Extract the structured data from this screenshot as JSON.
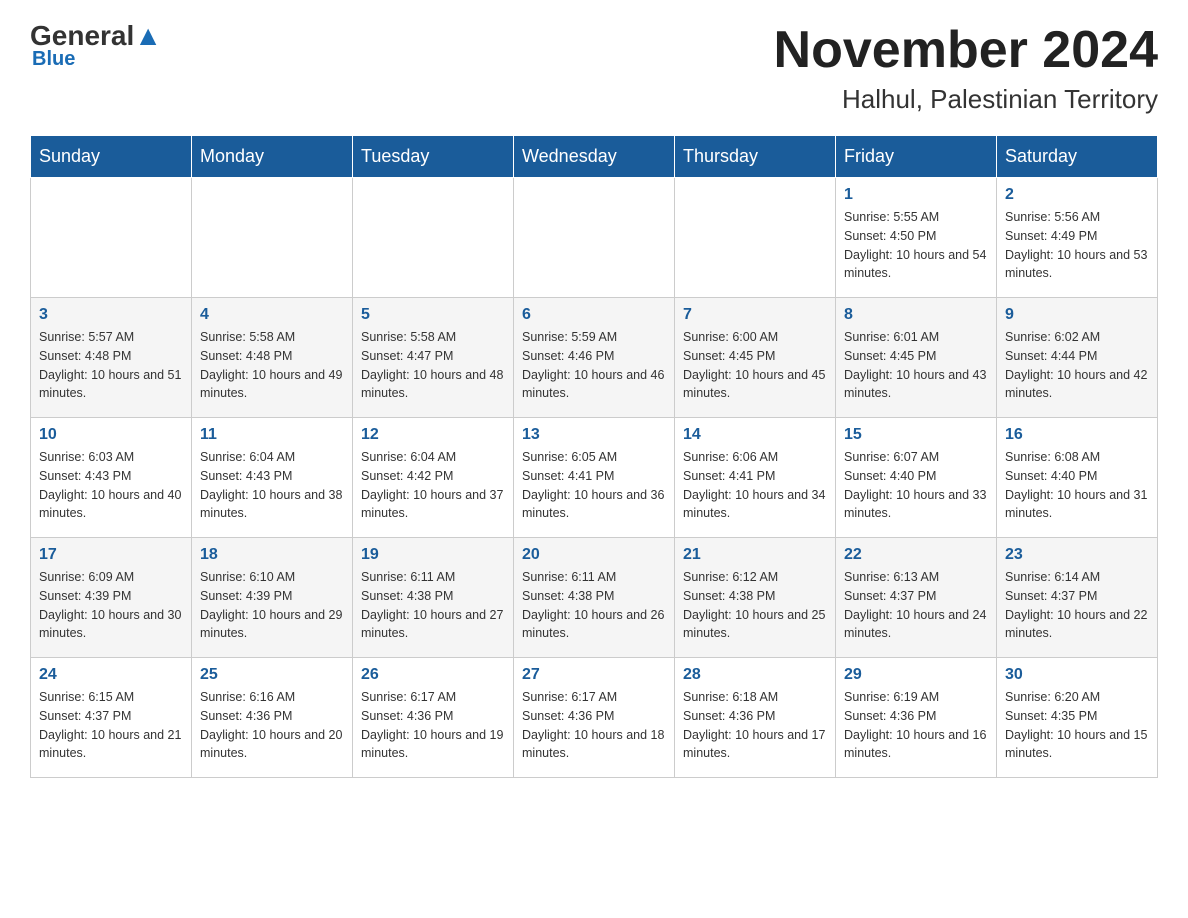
{
  "header": {
    "logo_general": "General",
    "logo_blue": "Blue",
    "month_title": "November 2024",
    "location": "Halhul, Palestinian Territory"
  },
  "days_of_week": [
    "Sunday",
    "Monday",
    "Tuesday",
    "Wednesday",
    "Thursday",
    "Friday",
    "Saturday"
  ],
  "weeks": [
    [
      {
        "day": "",
        "info": ""
      },
      {
        "day": "",
        "info": ""
      },
      {
        "day": "",
        "info": ""
      },
      {
        "day": "",
        "info": ""
      },
      {
        "day": "",
        "info": ""
      },
      {
        "day": "1",
        "info": "Sunrise: 5:55 AM\nSunset: 4:50 PM\nDaylight: 10 hours and 54 minutes."
      },
      {
        "day": "2",
        "info": "Sunrise: 5:56 AM\nSunset: 4:49 PM\nDaylight: 10 hours and 53 minutes."
      }
    ],
    [
      {
        "day": "3",
        "info": "Sunrise: 5:57 AM\nSunset: 4:48 PM\nDaylight: 10 hours and 51 minutes."
      },
      {
        "day": "4",
        "info": "Sunrise: 5:58 AM\nSunset: 4:48 PM\nDaylight: 10 hours and 49 minutes."
      },
      {
        "day": "5",
        "info": "Sunrise: 5:58 AM\nSunset: 4:47 PM\nDaylight: 10 hours and 48 minutes."
      },
      {
        "day": "6",
        "info": "Sunrise: 5:59 AM\nSunset: 4:46 PM\nDaylight: 10 hours and 46 minutes."
      },
      {
        "day": "7",
        "info": "Sunrise: 6:00 AM\nSunset: 4:45 PM\nDaylight: 10 hours and 45 minutes."
      },
      {
        "day": "8",
        "info": "Sunrise: 6:01 AM\nSunset: 4:45 PM\nDaylight: 10 hours and 43 minutes."
      },
      {
        "day": "9",
        "info": "Sunrise: 6:02 AM\nSunset: 4:44 PM\nDaylight: 10 hours and 42 minutes."
      }
    ],
    [
      {
        "day": "10",
        "info": "Sunrise: 6:03 AM\nSunset: 4:43 PM\nDaylight: 10 hours and 40 minutes."
      },
      {
        "day": "11",
        "info": "Sunrise: 6:04 AM\nSunset: 4:43 PM\nDaylight: 10 hours and 38 minutes."
      },
      {
        "day": "12",
        "info": "Sunrise: 6:04 AM\nSunset: 4:42 PM\nDaylight: 10 hours and 37 minutes."
      },
      {
        "day": "13",
        "info": "Sunrise: 6:05 AM\nSunset: 4:41 PM\nDaylight: 10 hours and 36 minutes."
      },
      {
        "day": "14",
        "info": "Sunrise: 6:06 AM\nSunset: 4:41 PM\nDaylight: 10 hours and 34 minutes."
      },
      {
        "day": "15",
        "info": "Sunrise: 6:07 AM\nSunset: 4:40 PM\nDaylight: 10 hours and 33 minutes."
      },
      {
        "day": "16",
        "info": "Sunrise: 6:08 AM\nSunset: 4:40 PM\nDaylight: 10 hours and 31 minutes."
      }
    ],
    [
      {
        "day": "17",
        "info": "Sunrise: 6:09 AM\nSunset: 4:39 PM\nDaylight: 10 hours and 30 minutes."
      },
      {
        "day": "18",
        "info": "Sunrise: 6:10 AM\nSunset: 4:39 PM\nDaylight: 10 hours and 29 minutes."
      },
      {
        "day": "19",
        "info": "Sunrise: 6:11 AM\nSunset: 4:38 PM\nDaylight: 10 hours and 27 minutes."
      },
      {
        "day": "20",
        "info": "Sunrise: 6:11 AM\nSunset: 4:38 PM\nDaylight: 10 hours and 26 minutes."
      },
      {
        "day": "21",
        "info": "Sunrise: 6:12 AM\nSunset: 4:38 PM\nDaylight: 10 hours and 25 minutes."
      },
      {
        "day": "22",
        "info": "Sunrise: 6:13 AM\nSunset: 4:37 PM\nDaylight: 10 hours and 24 minutes."
      },
      {
        "day": "23",
        "info": "Sunrise: 6:14 AM\nSunset: 4:37 PM\nDaylight: 10 hours and 22 minutes."
      }
    ],
    [
      {
        "day": "24",
        "info": "Sunrise: 6:15 AM\nSunset: 4:37 PM\nDaylight: 10 hours and 21 minutes."
      },
      {
        "day": "25",
        "info": "Sunrise: 6:16 AM\nSunset: 4:36 PM\nDaylight: 10 hours and 20 minutes."
      },
      {
        "day": "26",
        "info": "Sunrise: 6:17 AM\nSunset: 4:36 PM\nDaylight: 10 hours and 19 minutes."
      },
      {
        "day": "27",
        "info": "Sunrise: 6:17 AM\nSunset: 4:36 PM\nDaylight: 10 hours and 18 minutes."
      },
      {
        "day": "28",
        "info": "Sunrise: 6:18 AM\nSunset: 4:36 PM\nDaylight: 10 hours and 17 minutes."
      },
      {
        "day": "29",
        "info": "Sunrise: 6:19 AM\nSunset: 4:36 PM\nDaylight: 10 hours and 16 minutes."
      },
      {
        "day": "30",
        "info": "Sunrise: 6:20 AM\nSunset: 4:35 PM\nDaylight: 10 hours and 15 minutes."
      }
    ]
  ]
}
